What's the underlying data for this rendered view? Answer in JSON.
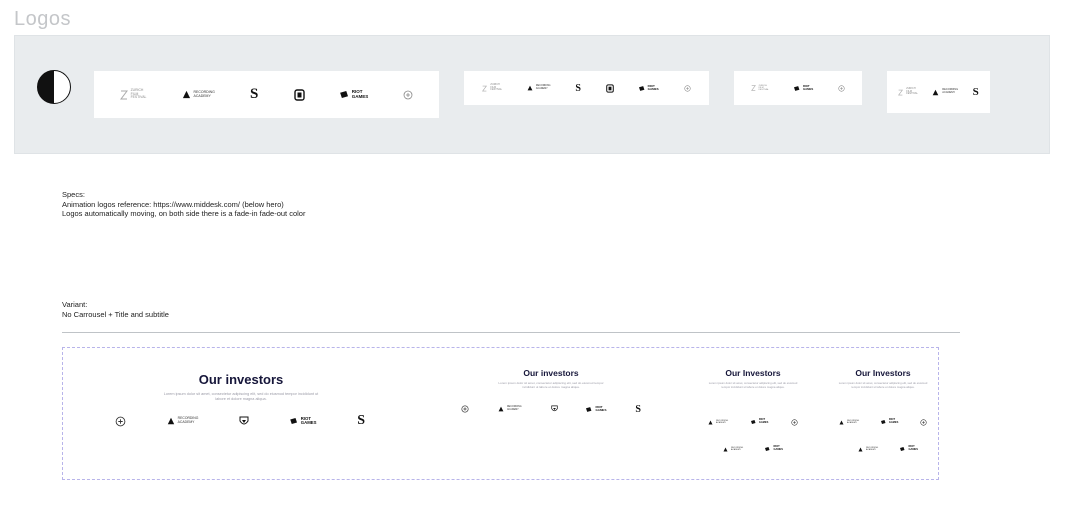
{
  "page": {
    "title": "Logos"
  },
  "logos": {
    "zff": [
      "ZURICH",
      "FILM",
      "FESTIVAL"
    ],
    "ra": [
      "RECORDING",
      "ACADEMY"
    ],
    "riot": [
      "RIOT",
      "GAMES"
    ],
    "s_letter": "S"
  },
  "specs": {
    "heading": "Specs:",
    "line1": "Animation logos reference: https://www.middesk.com/ (below hero)",
    "line2": "Logos automatically moving, on both side there is a fade-in fade-out color"
  },
  "variant": {
    "heading": "Variant:",
    "line1": "No Carrousel + Title and subtitle"
  },
  "investors": {
    "desktop_title": "Our investors",
    "tablet_title": "Our investors",
    "mobile_title": "Our Investors",
    "mobile2_title": "Our Investors",
    "subtitle": "Lorem ipsum dolor sit amet, consectetur adipiscing elit, sed do eiusmod tempor incididunt ut labore et dolore magna aliqua."
  },
  "colors": {
    "band": "#e9ecee",
    "title_grey": "#c4c6c9",
    "investor_title": "#16163a",
    "dashed_border": "#b8b4ea"
  }
}
